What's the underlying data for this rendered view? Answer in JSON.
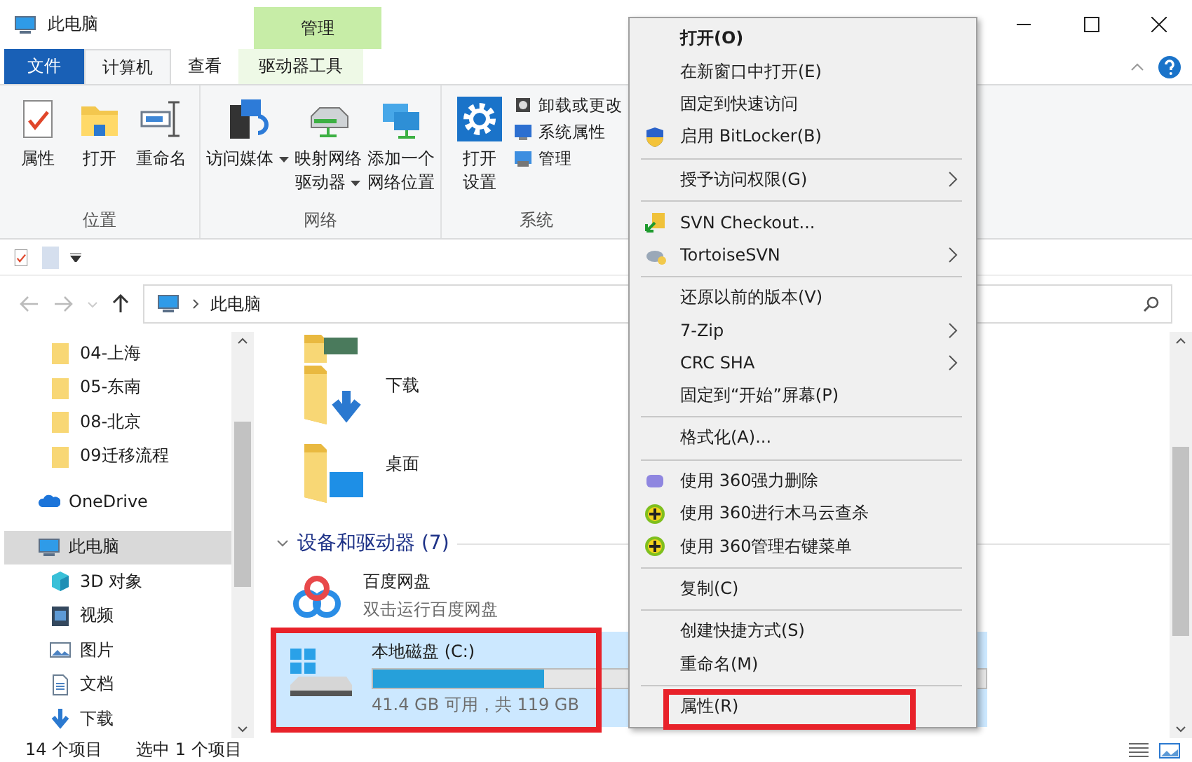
{
  "window": {
    "title": "此电脑",
    "context_tab": "管理"
  },
  "ribbon_tabs": [
    {
      "label": "文件",
      "kind": "file",
      "selected": false
    },
    {
      "label": "计算机",
      "kind": "tab",
      "selected": true
    },
    {
      "label": "查看",
      "kind": "tab",
      "selected": false
    },
    {
      "label": "驱动器工具",
      "kind": "context",
      "selected": false
    }
  ],
  "ribbon_groups": [
    {
      "label": "位置",
      "items": [
        {
          "kind": "large",
          "lines": [
            "属性"
          ],
          "dropdown": false
        },
        {
          "kind": "large",
          "lines": [
            "打开"
          ],
          "dropdown": false
        },
        {
          "kind": "large",
          "lines": [
            "重命名"
          ],
          "dropdown": false
        }
      ]
    },
    {
      "label": "网络",
      "items": [
        {
          "kind": "large",
          "lines": [
            "访问媒体"
          ],
          "dropdown": true
        },
        {
          "kind": "large",
          "lines": [
            "映射网络",
            "驱动器"
          ],
          "dropdown": true
        },
        {
          "kind": "large",
          "lines": [
            "添加一个",
            "网络位置"
          ],
          "dropdown": false
        }
      ]
    },
    {
      "label": "系统",
      "items": [
        {
          "kind": "large",
          "lines": [
            "打开",
            "设置"
          ],
          "dropdown": false
        },
        {
          "kind": "small",
          "lines": [
            "卸载或更改"
          ],
          "dropdown": false
        },
        {
          "kind": "small",
          "lines": [
            "系统属性"
          ],
          "dropdown": false
        },
        {
          "kind": "small",
          "lines": [
            "管理"
          ],
          "dropdown": false
        }
      ]
    }
  ],
  "address": {
    "path": "此电脑"
  },
  "nav": {
    "quick_access_items": [
      {
        "label": "04-上海"
      },
      {
        "label": "05-东南"
      },
      {
        "label": "08-北京"
      },
      {
        "label": "09迁移流程"
      }
    ],
    "items": [
      {
        "label": "OneDrive",
        "selected": false
      },
      {
        "label": "此电脑",
        "selected": true,
        "children": [
          {
            "label": "3D 对象",
            "selected": false
          },
          {
            "label": "视频",
            "selected": false
          },
          {
            "label": "图片",
            "selected": false
          },
          {
            "label": "文档",
            "selected": false
          },
          {
            "label": "下载",
            "selected": false
          }
        ]
      }
    ]
  },
  "content": {
    "folders": [
      {
        "label": "下载"
      },
      {
        "label": "桌面"
      }
    ],
    "group_header": "设备和驱动器 (7)",
    "devices": [
      {
        "kind": "app",
        "name": "百度网盘",
        "detail": "双击运行百度网盘",
        "selected": false,
        "highlighted": false
      },
      {
        "kind": "drive",
        "name": "本地磁盘 (C:)",
        "detail": "41.4 GB 可用，共 119 GB",
        "level": 0.28,
        "selected": true,
        "highlighted": true
      }
    ]
  },
  "status_bar": {
    "count": "14 个项目",
    "selection": "选中 1 个项目"
  },
  "context_menu": [
    {
      "kind": "item",
      "label": "打开(O)",
      "default": true,
      "submenu": false,
      "highlighted": false
    },
    {
      "kind": "item",
      "label": "在新窗口中打开(E)",
      "default": false,
      "submenu": false,
      "highlighted": false
    },
    {
      "kind": "item",
      "label": "固定到快速访问",
      "default": false,
      "submenu": false,
      "highlighted": false
    },
    {
      "kind": "item",
      "label": "启用 BitLocker(B)",
      "default": false,
      "submenu": false,
      "highlighted": false
    },
    {
      "kind": "separator"
    },
    {
      "kind": "item",
      "label": "授予访问权限(G)",
      "default": false,
      "submenu": true,
      "highlighted": false
    },
    {
      "kind": "separator"
    },
    {
      "kind": "item",
      "label": "SVN Checkout...",
      "default": false,
      "submenu": false,
      "highlighted": false
    },
    {
      "kind": "item",
      "label": "TortoiseSVN",
      "default": false,
      "submenu": true,
      "highlighted": false
    },
    {
      "kind": "separator"
    },
    {
      "kind": "item",
      "label": "还原以前的版本(V)",
      "default": false,
      "submenu": false,
      "highlighted": false
    },
    {
      "kind": "item",
      "label": "7-Zip",
      "default": false,
      "submenu": true,
      "highlighted": false
    },
    {
      "kind": "item",
      "label": "CRC SHA",
      "default": false,
      "submenu": true,
      "highlighted": false
    },
    {
      "kind": "item",
      "label": "固定到“开始”屏幕(P)",
      "default": false,
      "submenu": false,
      "highlighted": false
    },
    {
      "kind": "separator"
    },
    {
      "kind": "item",
      "label": "格式化(A)...",
      "default": false,
      "submenu": false,
      "highlighted": false
    },
    {
      "kind": "separator"
    },
    {
      "kind": "item",
      "label": "使用 360强力删除",
      "default": false,
      "submenu": false,
      "highlighted": false
    },
    {
      "kind": "item",
      "label": "使用 360进行木马云查杀",
      "default": false,
      "submenu": false,
      "highlighted": false
    },
    {
      "kind": "item",
      "label": "使用 360管理右键菜单",
      "default": false,
      "submenu": false,
      "highlighted": false
    },
    {
      "kind": "separator"
    },
    {
      "kind": "item",
      "label": "复制(C)",
      "default": false,
      "submenu": false,
      "highlighted": false
    },
    {
      "kind": "separator"
    },
    {
      "kind": "item",
      "label": "创建快捷方式(S)",
      "default": false,
      "submenu": false,
      "highlighted": false
    },
    {
      "kind": "item",
      "label": "重命名(M)",
      "default": false,
      "submenu": false,
      "highlighted": false
    },
    {
      "kind": "separator"
    },
    {
      "kind": "item",
      "label": "属性(R)",
      "default": false,
      "submenu": false,
      "highlighted": true
    }
  ]
}
